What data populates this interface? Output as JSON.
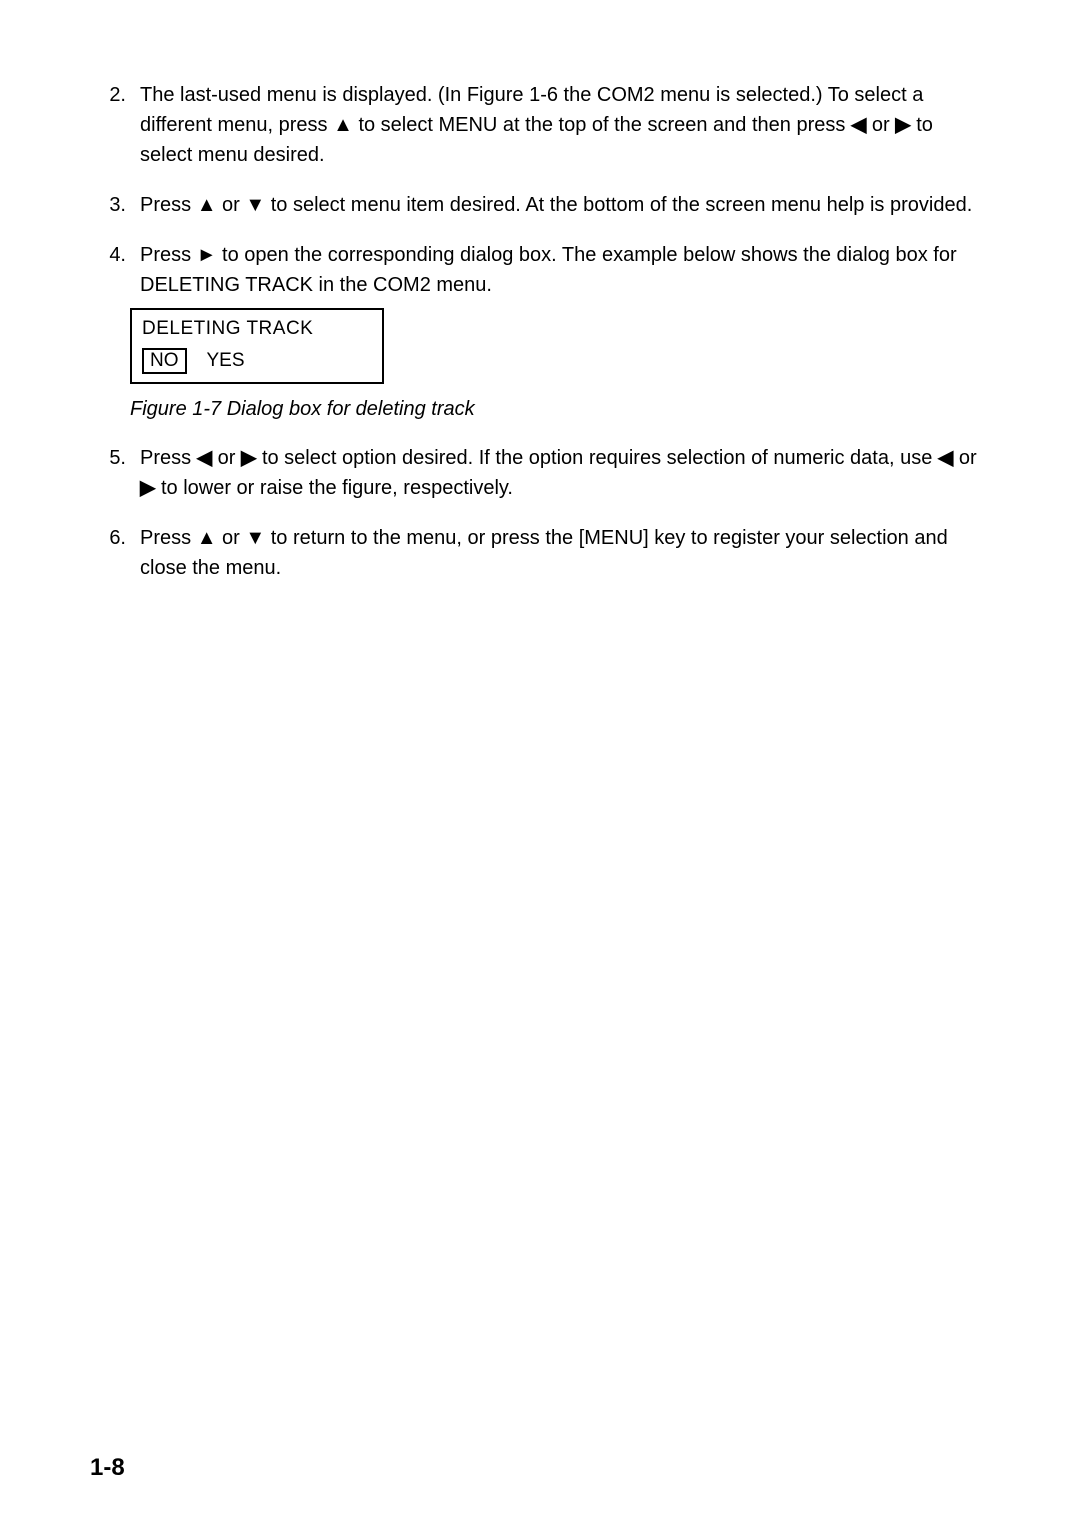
{
  "items": {
    "i2": {
      "num": "2.",
      "p1a": "The last-used menu is displayed. (In Figure 1-6 the COM2 menu is selected.) To select a different menu, press ",
      "up": "▲",
      "p1b": " to select MENU at the top of the screen and then press ",
      "left": "◀",
      "p1c": " or ",
      "right": "▶",
      "p1d": " to select menu desired."
    },
    "i3": {
      "num": "3.",
      "p1a": "Press ",
      "up": "▲",
      "p1b": " or ",
      "down": "▼",
      "p1c": " to select menu item desired. At the bottom of the screen menu help is provided."
    },
    "i4": {
      "num": "4.",
      "p1a": "Press ",
      "right": "►",
      "p1b": " to open the corresponding dialog box. The example below shows the dialog box for DELETING TRACK in the COM2 menu."
    },
    "i5": {
      "num": "5.",
      "p1a": "Press ",
      "left1": "◀",
      "p1b": " or ",
      "right1": "▶",
      "p1c": " to select option desired. If the option requires selection of numeric data, use ",
      "left2": "◀",
      "p1d": " or ",
      "right2": "▶",
      "p1e": " to lower or raise the figure, respectively."
    },
    "i6": {
      "num": "6.",
      "p1a": "Press ",
      "up": "▲",
      "p1b": " or ",
      "down": "▼",
      "p1c": " to return to the menu, or press the [MENU] key to register your selection and close the menu."
    }
  },
  "dialog": {
    "title": "DELETING TRACK",
    "opt_no": "NO",
    "opt_yes": "YES"
  },
  "caption": "Figure 1-7 Dialog box for deleting track",
  "footer": "1-8"
}
